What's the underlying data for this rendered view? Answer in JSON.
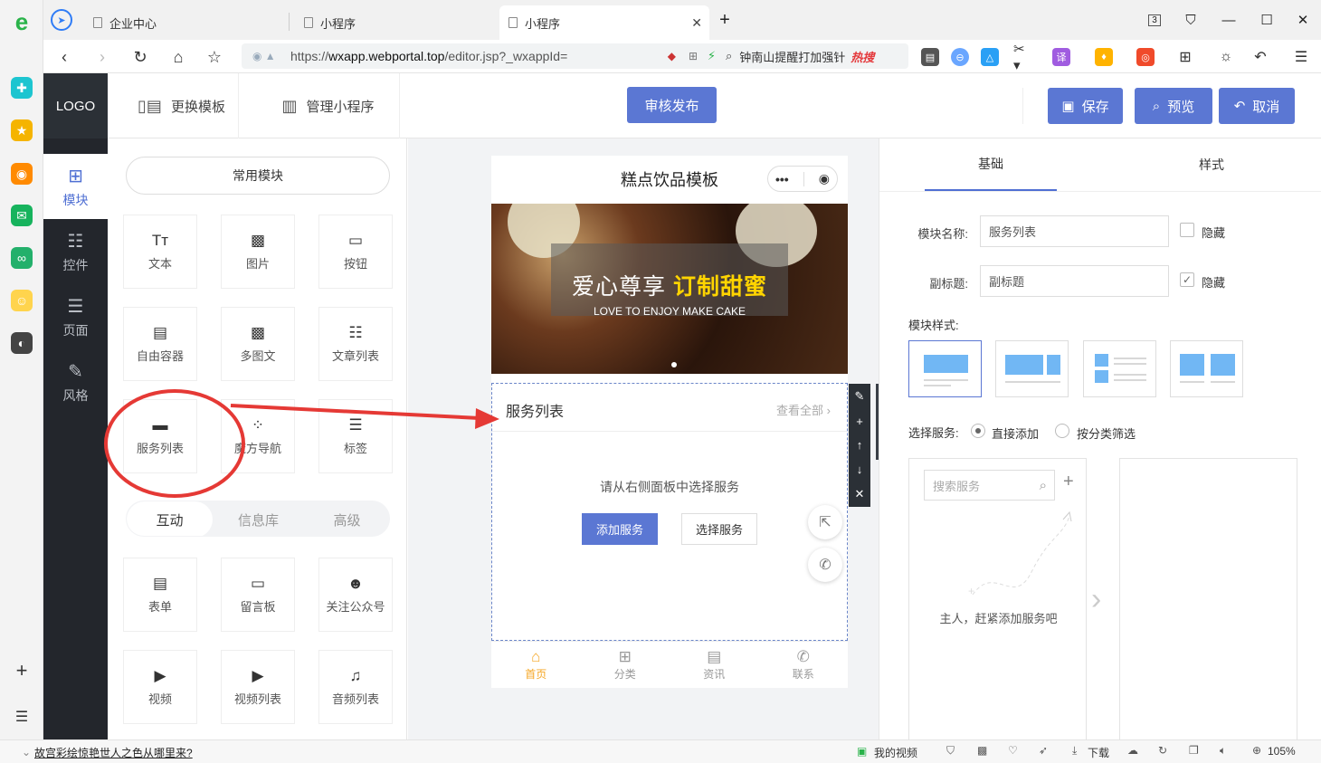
{
  "browser": {
    "tabs": [
      {
        "label": "企业中心"
      },
      {
        "label": "小程序"
      },
      {
        "label": "小程序"
      }
    ],
    "tab_count": "3",
    "url_prefix": "https://",
    "url_domain": "wxapp.webportal.top",
    "url_path": "/editor.jsp?_wxappId=",
    "search_text": "钟南山提醒打加强针",
    "search_hot": "热搜"
  },
  "header": {
    "logo": "LOGO",
    "change_template": "更换模板",
    "manage": "管理小程序",
    "publish": "审核发布",
    "save": "保存",
    "preview": "预览",
    "cancel": "取消"
  },
  "sidebar": {
    "items": [
      {
        "label": "模块"
      },
      {
        "label": "控件"
      },
      {
        "label": "页面"
      },
      {
        "label": "风格"
      }
    ]
  },
  "modules": {
    "common_title": "常用模块",
    "common": [
      {
        "label": "文本"
      },
      {
        "label": "图片"
      },
      {
        "label": "按钮"
      },
      {
        "label": "自由容器"
      },
      {
        "label": "多图文"
      },
      {
        "label": "文章列表"
      },
      {
        "label": "服务列表"
      },
      {
        "label": "魔方导航"
      },
      {
        "label": "标签"
      }
    ],
    "tabs": [
      {
        "label": "互动"
      },
      {
        "label": "信息库"
      },
      {
        "label": "高级"
      }
    ],
    "interactive": [
      {
        "label": "表单"
      },
      {
        "label": "留言板"
      },
      {
        "label": "关注公众号"
      },
      {
        "label": "视频"
      },
      {
        "label": "视频列表"
      },
      {
        "label": "音频列表"
      }
    ]
  },
  "phone": {
    "title": "糕点饮品模板",
    "banner_text": "爱心尊享",
    "banner_highlight": "订制甜蜜",
    "banner_sub": "LOVE TO ENJOY MAKE CAKE",
    "service_title": "服务列表",
    "view_all": "查看全部",
    "empty_hint": "请从右侧面板中选择服务",
    "add_service": "添加服务",
    "select_service": "选择服务",
    "nav": [
      {
        "label": "首页"
      },
      {
        "label": "分类"
      },
      {
        "label": "资讯"
      },
      {
        "label": "联系"
      }
    ]
  },
  "settings": {
    "tabs": [
      {
        "label": "基础"
      },
      {
        "label": "样式"
      }
    ],
    "name_label": "模块名称:",
    "name_value": "服务列表",
    "hide_label": "隐藏",
    "subtitle_label": "副标题:",
    "subtitle_value": "副标题",
    "style_label": "模块样式:",
    "select_label": "选择服务:",
    "option_direct": "直接添加",
    "option_category": "按分类筛选",
    "search_placeholder": "搜索服务",
    "empty_text": "主人，赶紧添加服务吧"
  },
  "statusbar": {
    "news": "故宫彩绘惊艳世人之色从哪里来?",
    "my_video": "我的视频",
    "download": "下载",
    "zoom": "105%"
  },
  "colors": {
    "primary": "#5b77d3",
    "dark": "#23262c",
    "accent_orange": "#f5a623",
    "annotation_red": "#e53935"
  }
}
